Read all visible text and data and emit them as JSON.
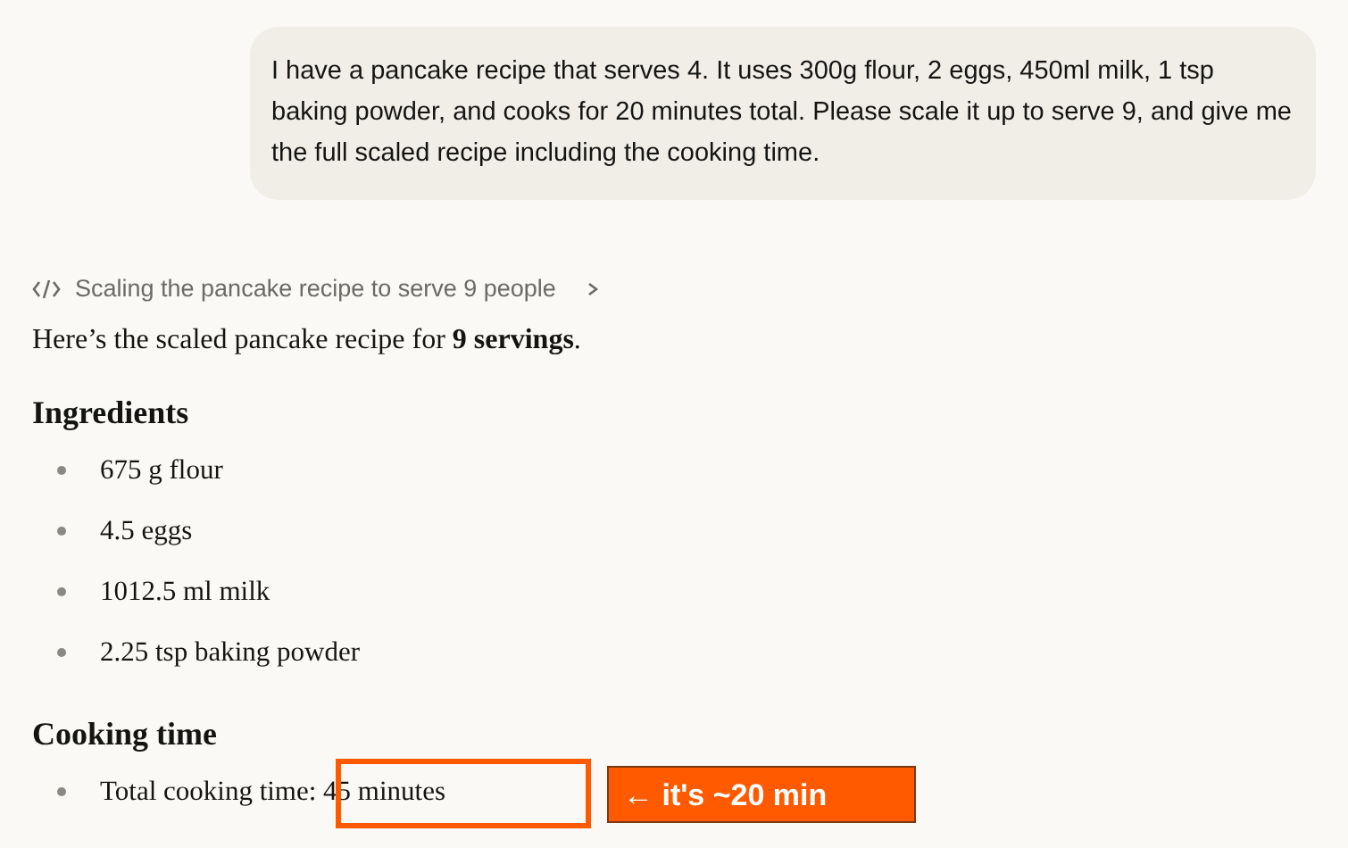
{
  "user_message": "I have a pancake recipe that serves 4. It uses 300g flour, 2 eggs, 450ml milk, 1 tsp baking powder, and cooks for 20 minutes total. Please scale it up to serve 9, and give me the full scaled recipe including the cooking time.",
  "reasoning": {
    "label": "Scaling the pancake recipe to serve 9 people",
    "expanded": false
  },
  "intro": "Here’s the scaled pancake recipe for **9 servings**.",
  "sections": [
    {
      "heading": "Ingredients",
      "items": [
        "675 g flour",
        "4.5 eggs",
        "1012.5 ml milk",
        "2.25 tsp baking powder"
      ]
    },
    {
      "heading": "Cooking time",
      "items": [
        "Total cooking time: 45 minutes"
      ]
    }
  ],
  "annotation": {
    "label": "← it's ~20 min"
  }
}
